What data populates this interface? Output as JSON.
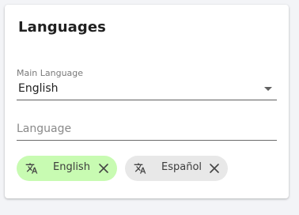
{
  "card": {
    "title": "Languages"
  },
  "main_language": {
    "label": "Main Language",
    "value": "English"
  },
  "language_input": {
    "placeholder": "Language",
    "value": ""
  },
  "chips": [
    {
      "label": "English",
      "icon": "translate-icon",
      "color": "#c8fbb2",
      "selected": true
    },
    {
      "label": "Español",
      "icon": "translate-icon",
      "color": "#e8e8e8",
      "selected": false
    }
  ]
}
